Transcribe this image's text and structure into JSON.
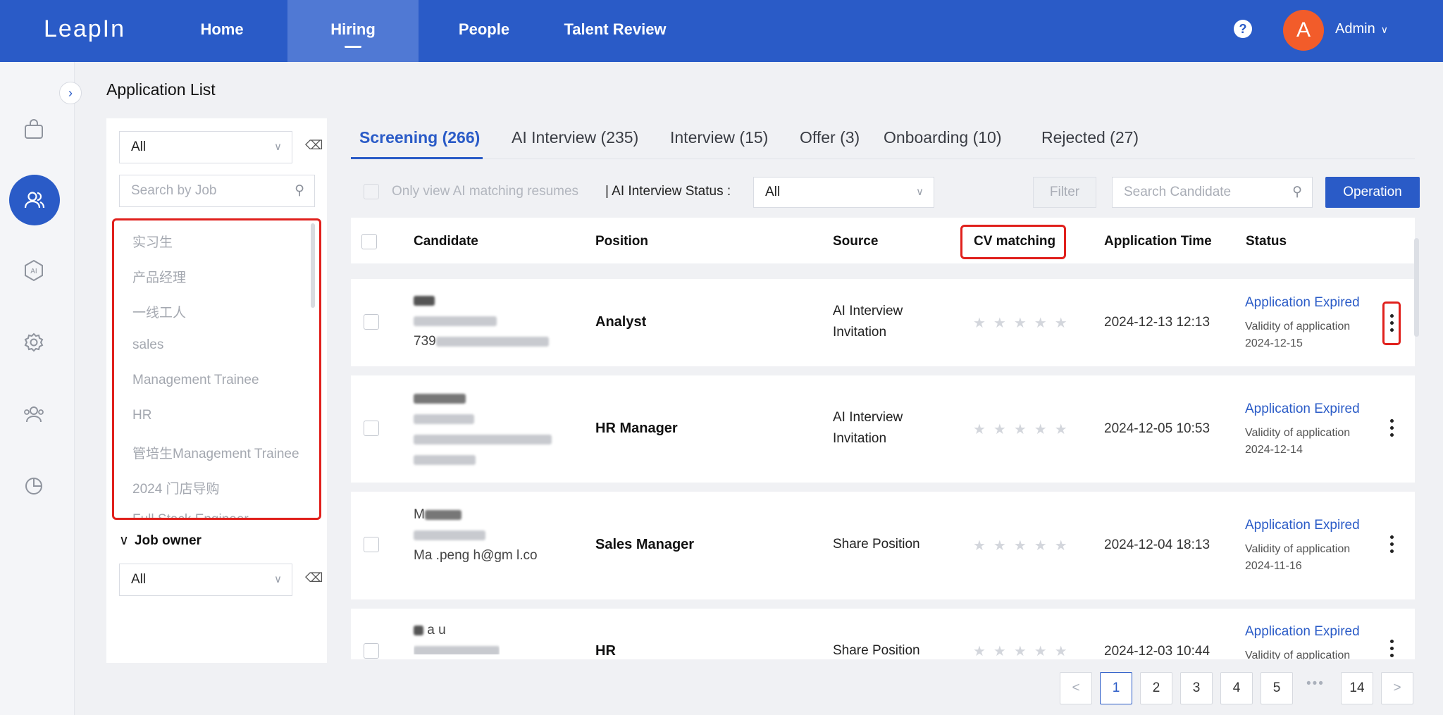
{
  "app": {
    "logo": "LeapIn",
    "nav": [
      "Home",
      "Hiring",
      "People",
      "Talent Review"
    ],
    "active_nav": "Hiring",
    "help": "?",
    "avatar_letter": "A",
    "user": "Admin"
  },
  "page": {
    "title": "Application List"
  },
  "filters": {
    "department_select": "All",
    "job_search_placeholder": "Search by Job",
    "jobs": [
      "实习生",
      "产品经理",
      "一线工人",
      "sales",
      "Management Trainee",
      "HR",
      "管培生Management Trainee",
      "2024 门店导购",
      "Full Stack Engineer"
    ],
    "job_owner_label": "Job owner",
    "job_owner_select": "All"
  },
  "tabs": [
    "Screening (266)",
    "AI Interview (235)",
    "Interview (15)",
    "Offer (3)",
    "Onboarding (10)",
    "Rejected (27)"
  ],
  "toolbar": {
    "ai_matching_label": "Only view AI matching resumes",
    "ai_status_label": "AI Interview Status :",
    "ai_status_value": "All",
    "filter_button": "Filter",
    "search_placeholder": "Search Candidate",
    "operation_button": "Operation"
  },
  "table": {
    "headers": [
      "Candidate",
      "Position",
      "Source",
      "CV matching",
      "Application Time",
      "Status"
    ],
    "rows": [
      {
        "candidate_email_prefix": "739",
        "position": "Analyst",
        "source_line1": "AI Interview",
        "source_line2": "Invitation",
        "cv_matching_stars": 0,
        "application_time": "2024-12-13 12:13",
        "status": "Application Expired",
        "validity_label": "Validity of application",
        "validity_date": "2024-12-15"
      },
      {
        "position": "HR Manager",
        "source_line1": "AI Interview",
        "source_line2": "Invitation",
        "cv_matching_stars": 0,
        "application_time": "2024-12-05 10:53",
        "status": "Application Expired",
        "validity_label": "Validity of application",
        "validity_date": "2024-12-14"
      },
      {
        "candidate_name_prefix": "M",
        "candidate_email_partial": "Ma  .peng  h@gm  l.co",
        "position": "Sales Manager",
        "source_line1": "Share Position",
        "source_line2": "",
        "cv_matching_stars": 0,
        "application_time": "2024-12-04 18:13",
        "status": "Application Expired",
        "validity_label": "Validity of application",
        "validity_date": "2024-11-16"
      },
      {
        "candidate_name_partial": "a   u",
        "position": "HR",
        "source_line1": "Share Position",
        "source_line2": "",
        "cv_matching_stars": 0,
        "application_time": "2024-12-03 10:44",
        "status": "Application Expired",
        "validity_label": "Validity of application",
        "validity_date": ""
      }
    ]
  },
  "pagination": {
    "prev": "<",
    "pages": [
      "1",
      "2",
      "3",
      "4",
      "5"
    ],
    "ellipsis": "•••",
    "last": "14",
    "next": ">",
    "current": "1"
  },
  "colors": {
    "brand": "#2a5bc7",
    "highlight": "#e0201c",
    "avatar": "#f25c2a"
  }
}
